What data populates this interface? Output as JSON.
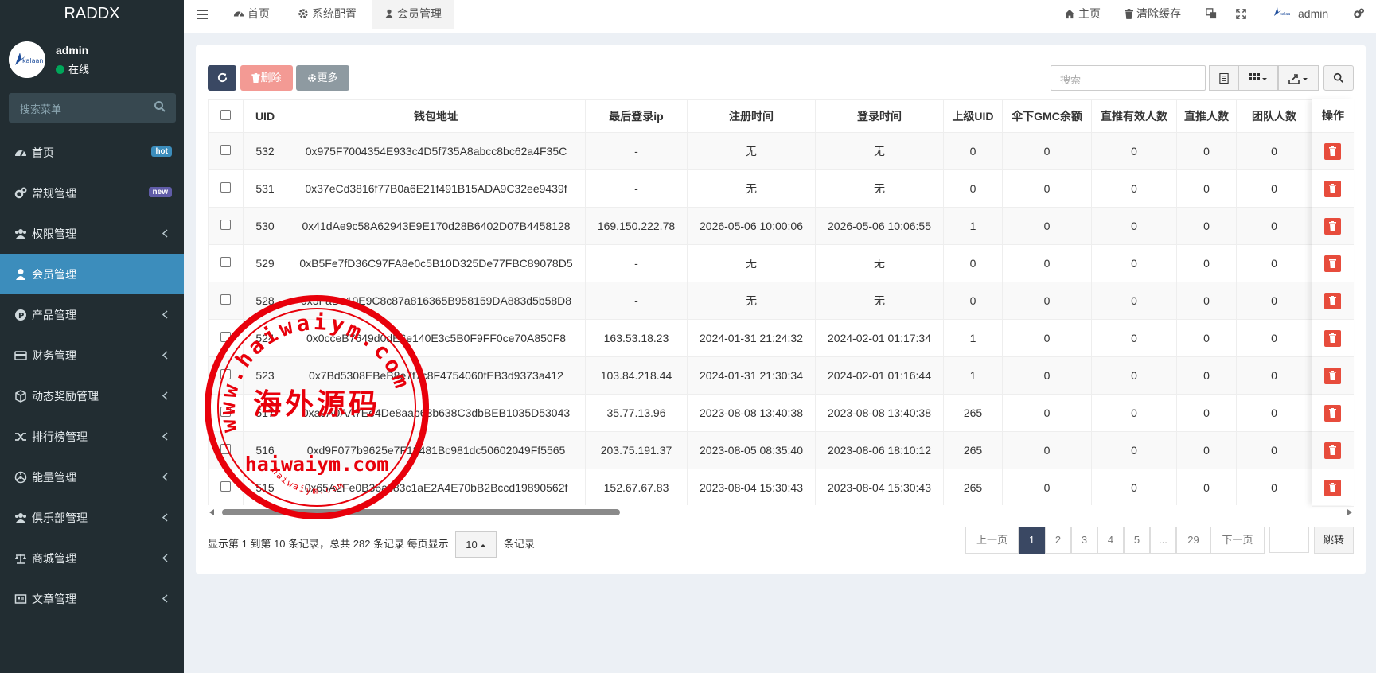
{
  "sidebar": {
    "brand": "RADDX",
    "user": {
      "name": "admin",
      "status": "在线"
    },
    "search_placeholder": "搜索菜单",
    "items": [
      {
        "label": "首页",
        "icon": "dashboard-icon",
        "badge": "hot"
      },
      {
        "label": "常规管理",
        "icon": "cogs-icon",
        "badge": "new"
      },
      {
        "label": "权限管理",
        "icon": "group-icon"
      },
      {
        "label": "会员管理",
        "icon": "user-icon",
        "active": true
      },
      {
        "label": "产品管理",
        "icon": "product-p-icon"
      },
      {
        "label": "财务管理",
        "icon": "credit-card-icon"
      },
      {
        "label": "动态奖励管理",
        "icon": "cube-icon"
      },
      {
        "label": "排行榜管理",
        "icon": "random-icon"
      },
      {
        "label": "能量管理",
        "icon": "energy-icon"
      },
      {
        "label": "俱乐部管理",
        "icon": "group-icon"
      },
      {
        "label": "商城管理",
        "icon": "balance-scale-icon"
      },
      {
        "label": "文章管理",
        "icon": "newspaper-icon"
      }
    ]
  },
  "topbar": {
    "tabs": [
      {
        "label": "首页",
        "icon": "dashboard-icon"
      },
      {
        "label": "系统配置",
        "icon": "gear-icon"
      },
      {
        "label": "会员管理",
        "icon": "user-icon",
        "active": true
      }
    ],
    "home_label": "主页",
    "clear_cache_label": "清除缓存",
    "admin_label": "admin"
  },
  "toolbar": {
    "delete_label": "删除",
    "more_label": "更多",
    "search_placeholder": "搜索"
  },
  "table": {
    "columns": [
      "UID",
      "钱包地址",
      "最后登录ip",
      "注册时间",
      "登录时间",
      "上级UID",
      "伞下GMC余额",
      "直推有效人数",
      "直推人数",
      "团队人数",
      "团"
    ],
    "op_header": "操作",
    "rows": [
      [
        "532",
        "0x975F7004354E933c4D5f735A8abcc8bc62a4F35C",
        "-",
        "无",
        "无",
        "0",
        "0",
        "0",
        "0",
        "0",
        ""
      ],
      [
        "531",
        "0x37eCd3816f77B0a6E21f491B15ADA9C32ee9439f",
        "-",
        "无",
        "无",
        "0",
        "0",
        "0",
        "0",
        "0",
        ""
      ],
      [
        "530",
        "0x41dAe9c58A62943E9E170d28B6402D07B4458128",
        "169.150.222.78",
        "2026-05-06 10:00:06",
        "2026-05-06 10:06:55",
        "1",
        "0",
        "0",
        "0",
        "0",
        ""
      ],
      [
        "529",
        "0xB5Fe7fD36C97FA8e0c5B10D325De77FBC89078D5",
        "-",
        "无",
        "无",
        "0",
        "0",
        "0",
        "0",
        "0",
        ""
      ],
      [
        "528",
        "0x5FaDe10E9C8c87a816365B958159DA883d5b58D8",
        "-",
        "无",
        "无",
        "0",
        "0",
        "0",
        "0",
        "0",
        ""
      ],
      [
        "524",
        "0x0cceB7649d0dE6e140E3c5B0F9FF0ce70A850F8",
        "163.53.18.23",
        "2024-01-31 21:24:32",
        "2024-02-01 01:17:34",
        "1",
        "0",
        "0",
        "0",
        "0",
        ""
      ],
      [
        "523",
        "0x7Bd5308EBeB8e7f7c8F4754060fEB3d9373a412",
        "103.84.218.44",
        "2024-01-31 21:30:34",
        "2024-02-01 01:16:44",
        "1",
        "0",
        "0",
        "0",
        "0",
        ""
      ],
      [
        "517",
        "0xa9A0AA7Ee4De8aab63b638C3dbBEB1035D53043",
        "35.77.13.96",
        "2023-08-08 13:40:38",
        "2023-08-08 13:40:38",
        "265",
        "0",
        "0",
        "0",
        "0",
        ""
      ],
      [
        "516",
        "0xd9F077b9625e7F12481Bc981dc50602049Ff5565",
        "203.75.191.37",
        "2023-08-05 08:35:40",
        "2023-08-06 18:10:12",
        "265",
        "0",
        "0",
        "0",
        "0",
        ""
      ],
      [
        "515",
        "0x65A2Fe0B36ac83c1aE2A4E70bB2Bccd19890562f",
        "152.67.67.83",
        "2023-08-04 15:30:43",
        "2023-08-04 15:30:43",
        "265",
        "0",
        "0",
        "0",
        "0",
        ""
      ]
    ]
  },
  "pagination": {
    "info_prefix": "显示第 1 到第 10 条记录，总共 282 条记录 每页显示",
    "page_size": "10",
    "info_suffix": "条记录",
    "prev": "上一页",
    "pages": [
      "1",
      "2",
      "3",
      "4",
      "5",
      "...",
      "29"
    ],
    "next": "下一页",
    "jump": "跳转",
    "current": "1"
  },
  "watermark": {
    "top_arc": "www.haiwaiym.com",
    "center": "海外源码",
    "bottom": "haiwaiym.com",
    "small_arc": "haiwaiym.com"
  }
}
